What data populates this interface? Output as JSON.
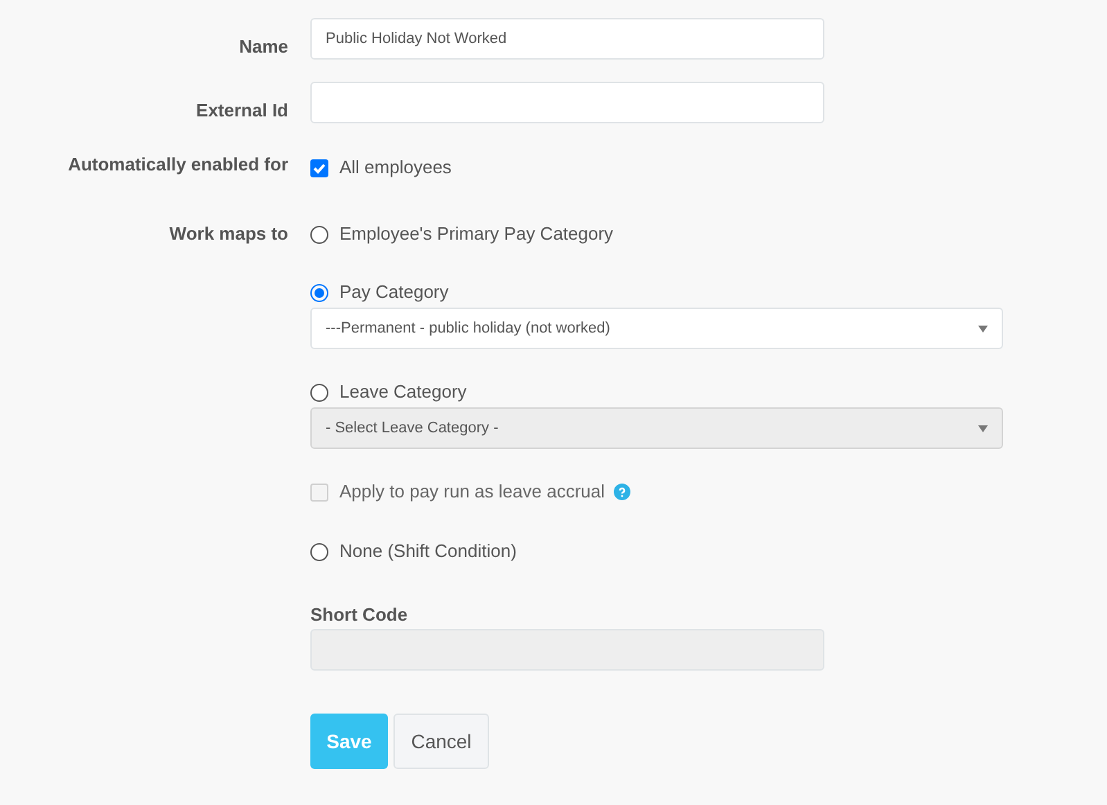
{
  "name": {
    "label": "Name",
    "value": "Public Holiday Not Worked"
  },
  "external_id": {
    "label": "External Id"
  },
  "auto_enabled": {
    "label": "Automatically enabled for",
    "option": "All employees",
    "checked": true
  },
  "work_maps_to": {
    "label": "Work maps to",
    "options": [
      {
        "kind": "radio",
        "label": "Employee's Primary Pay Category",
        "selected": false
      },
      {
        "kind": "radio",
        "label": "Pay Category",
        "selected": true,
        "select": {
          "value": "---Permanent - public holiday (not worked)",
          "disabled": false
        }
      },
      {
        "kind": "radio",
        "label": "Leave Category",
        "selected": false,
        "select": {
          "value": "- Select Leave Category -",
          "disabled": true
        }
      },
      {
        "kind": "checkbox",
        "label": "Apply to pay run as leave accrual",
        "checked": false,
        "disabled": true,
        "help": true
      },
      {
        "kind": "radio",
        "label": "None (Shift Condition)",
        "selected": false
      }
    ]
  },
  "short_code": {
    "label": "Short Code",
    "disabled": true
  },
  "buttons": [
    {
      "label": "Save",
      "kind": "primary"
    },
    {
      "label": "Cancel",
      "kind": "default"
    }
  ]
}
